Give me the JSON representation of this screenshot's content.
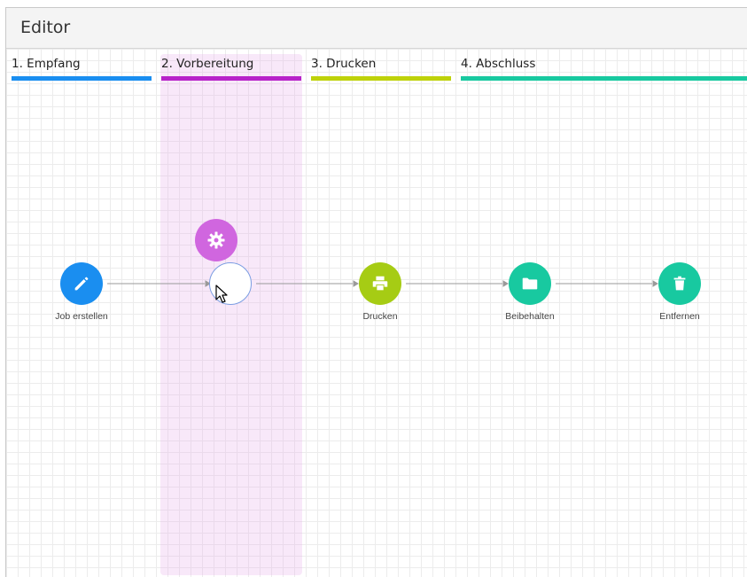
{
  "header": {
    "title": "Editor"
  },
  "lanes": [
    {
      "title": "1. Empfang",
      "color": "#1a8ef0"
    },
    {
      "title": "2. Vorbereitung",
      "color": "#b722c9"
    },
    {
      "title": "3. Drucken",
      "color": "#bed20a"
    },
    {
      "title": "4. Abschluss",
      "color": "#18c9a0"
    }
  ],
  "nodes": [
    {
      "label": "Job erstellen",
      "icon": "pencil-icon",
      "color": "#1a8ef0"
    },
    {
      "label": "",
      "icon": "empty-node"
    },
    {
      "label": "Drucken",
      "icon": "printer-icon",
      "color": "#a6cc14"
    },
    {
      "label": "Beibehalten",
      "icon": "folder-icon",
      "color": "#18c9a0"
    },
    {
      "label": "Entfernen",
      "icon": "trash-icon",
      "color": "#18c9a0"
    }
  ],
  "drag_item": {
    "icon": "gear-icon",
    "color": "#d066df"
  },
  "highlight_color": "#f5e4f8"
}
